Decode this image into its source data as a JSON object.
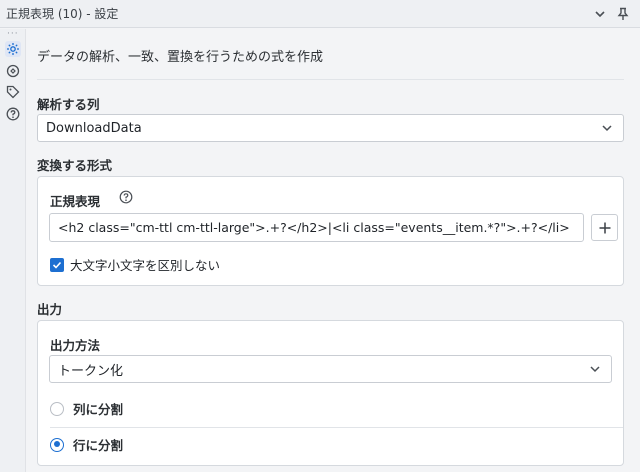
{
  "window": {
    "title": "正規表現 (10) - 設定"
  },
  "rail": {
    "icons": [
      "gear-icon",
      "meta-info-icon",
      "tag-icon",
      "help-icon"
    ]
  },
  "description": "データの解析、一致、置換を行うための式を作成",
  "parse_column": {
    "label": "解析する列",
    "value": "DownloadData"
  },
  "convert_format": {
    "label": "変換する形式",
    "regex_label": "正規表現",
    "regex_value": "<h2 class=\"cm-ttl cm-ttl-large\">.+?</h2>|<li class=\"events__item.*?\">.+?</li>",
    "case_insensitive_label": "大文字小文字を区別しない",
    "case_insensitive_checked": true
  },
  "output": {
    "label": "出力",
    "method_label": "出力方法",
    "method_value": "トークン化",
    "options": [
      {
        "label": "列に分割",
        "selected": false
      },
      {
        "label": "行に分割",
        "selected": true
      }
    ]
  },
  "colors": {
    "accent": "#1d6fd1",
    "background": "#f3f4f6",
    "card": "#ffffff"
  }
}
